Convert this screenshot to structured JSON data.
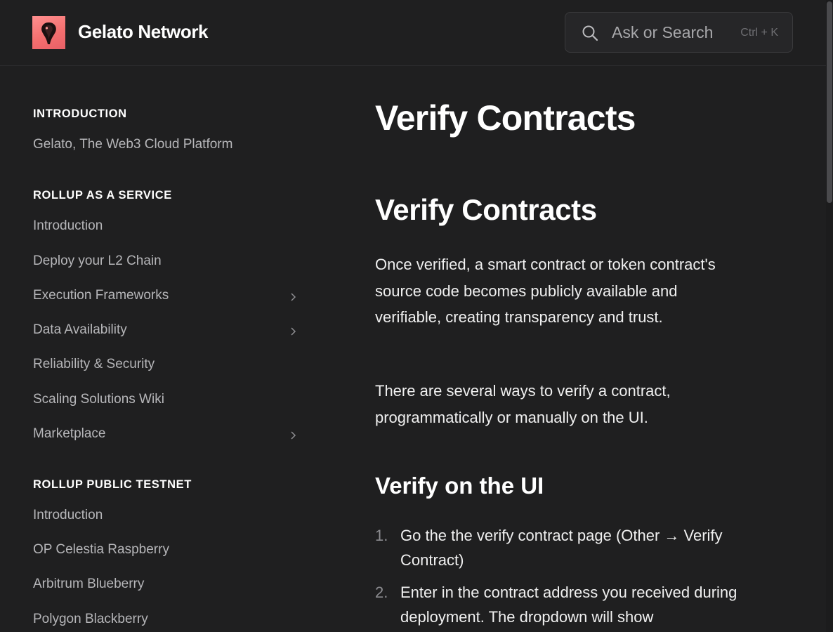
{
  "header": {
    "brand": "Gelato Network",
    "logo_icon": "gelato-logo",
    "search": {
      "placeholder": "Ask or Search",
      "shortcut": "Ctrl + K",
      "icon": "search-icon"
    }
  },
  "sidebar": {
    "sections": [
      {
        "title": "INTRODUCTION",
        "items": [
          {
            "label": "Gelato, The Web3 Cloud Platform",
            "expandable": false
          }
        ]
      },
      {
        "title": "ROLLUP AS A SERVICE",
        "items": [
          {
            "label": "Introduction",
            "expandable": false
          },
          {
            "label": "Deploy your L2 Chain",
            "expandable": false
          },
          {
            "label": "Execution Frameworks",
            "expandable": true
          },
          {
            "label": "Data Availability",
            "expandable": true
          },
          {
            "label": "Reliability & Security",
            "expandable": false
          },
          {
            "label": "Scaling Solutions Wiki",
            "expandable": false
          },
          {
            "label": "Marketplace",
            "expandable": true
          }
        ]
      },
      {
        "title": "ROLLUP PUBLIC TESTNET",
        "items": [
          {
            "label": "Introduction",
            "expandable": false
          },
          {
            "label": "OP Celestia Raspberry",
            "expandable": false
          },
          {
            "label": "Arbitrum Blueberry",
            "expandable": false
          },
          {
            "label": "Polygon Blackberry",
            "expandable": false
          }
        ]
      }
    ]
  },
  "main": {
    "page_title": "Verify Contracts",
    "section_title": "Verify Contracts",
    "paragraphs": [
      "Once verified, a smart contract or token contract's source code becomes publicly available and verifiable, creating transparency and trust.",
      "There are several ways to verify a contract, programmatically or manually on the UI."
    ],
    "subsection_title": "Verify on the UI",
    "steps": [
      {
        "num": "1.",
        "text": "Go the the verify contract page (Other → Verify Contract)"
      },
      {
        "num": "2.",
        "text": "Enter in the contract address you received during deployment. The dropdown will show"
      }
    ]
  },
  "colors": {
    "background": "#1f1f20",
    "text_primary": "#ffffff",
    "text_muted": "#b6b6b9",
    "logo_accent": "#f46f6f"
  }
}
